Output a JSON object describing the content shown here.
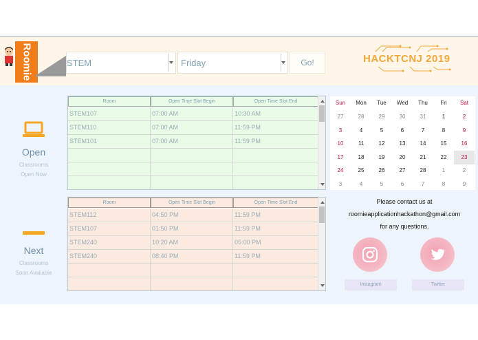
{
  "header": {
    "logo_text": "Roomie",
    "building_select": {
      "value": "STEM"
    },
    "day_select": {
      "value": "Friday"
    },
    "go_label": "Go!",
    "hackathon_logo": "HACKTCNJ 2019"
  },
  "sidebar": {
    "open": {
      "title": "Open",
      "sub1": "Classrooms",
      "sub2": "Open Now"
    },
    "next": {
      "title": "Next",
      "sub1": "Classrooms",
      "sub2": "Soon Available"
    }
  },
  "open_table": {
    "headers": [
      "Room",
      "Open Time Slot Begin",
      "Open Time Slot End"
    ],
    "rows": [
      [
        "STEM107",
        "07:00 AM",
        "10:30 AM"
      ],
      [
        "STEM110",
        "07:00 AM",
        "11:59 PM"
      ],
      [
        "STEM101",
        "07:00 AM",
        "11:59 PM"
      ],
      [
        "",
        "",
        ""
      ],
      [
        "",
        "",
        ""
      ],
      [
        "",
        "",
        ""
      ]
    ]
  },
  "next_table": {
    "headers": [
      "Room",
      "Open Time Slot Begin",
      "Open Time Slot End"
    ],
    "rows": [
      [
        "STEM112",
        "04:50 PM",
        "11:59 PM"
      ],
      [
        "STEM107",
        "01:50 PM",
        "11:59 PM"
      ],
      [
        "STEM240",
        "10:20 AM",
        "05:00 PM"
      ],
      [
        "STEM240",
        "08:40 PM",
        "11:59 PM"
      ],
      [
        "",
        "",
        ""
      ],
      [
        "",
        "",
        ""
      ]
    ]
  },
  "calendar": {
    "weekdays": [
      "Sun",
      "Mon",
      "Tue",
      "Wed",
      "Thu",
      "Fri",
      "Sat"
    ],
    "weeks": [
      [
        "27",
        "28",
        "29",
        "30",
        "31",
        "1",
        "2"
      ],
      [
        "3",
        "4",
        "5",
        "6",
        "7",
        "8",
        "9"
      ],
      [
        "10",
        "11",
        "12",
        "13",
        "14",
        "15",
        "16"
      ],
      [
        "17",
        "18",
        "19",
        "20",
        "21",
        "22",
        "23"
      ],
      [
        "24",
        "25",
        "26",
        "27",
        "28",
        "1",
        "2"
      ],
      [
        "3",
        "4",
        "5",
        "6",
        "7",
        "8",
        "9"
      ]
    ],
    "today": "23"
  },
  "contact": {
    "line1": "Please contact us at",
    "email": "roomieapplicationhackathon@gmail.com",
    "line3": "for any questions."
  },
  "social": {
    "instagram_label": "Instagram",
    "twitter_label": "Twitter"
  },
  "colors": {
    "header_bg": "#fdf6e9",
    "body_bg": "#eef4fb",
    "accent_orange": "#f07c1a",
    "open_table_bg": "#e9fbe6",
    "next_table_bg": "#fbeadf",
    "weekend_red": "#c0143c"
  }
}
